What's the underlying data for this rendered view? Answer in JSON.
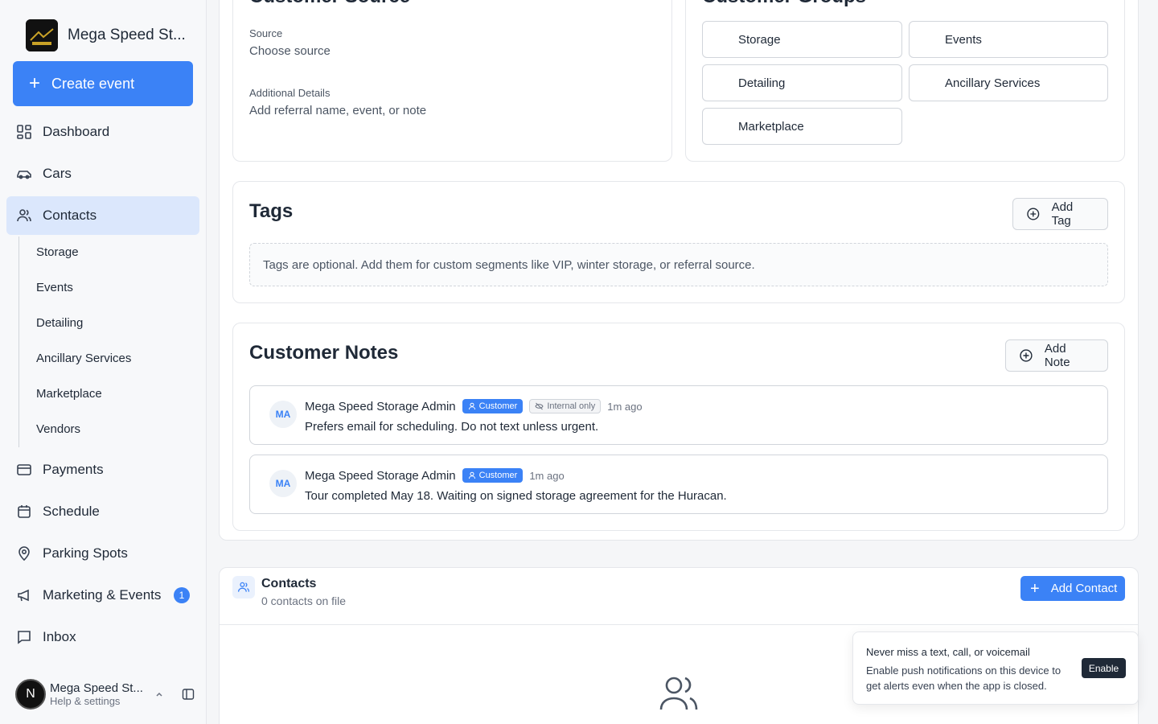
{
  "sidebar": {
    "brand_name": "Mega Speed St...",
    "create_label": "Create event",
    "nav": {
      "dashboard": "Dashboard",
      "cars": "Cars",
      "contacts": "Contacts",
      "payments": "Payments",
      "schedule": "Schedule",
      "parking": "Parking Spots",
      "marketing": "Marketing & Events",
      "marketing_badge": "1",
      "inbox": "Inbox"
    },
    "sub_items": [
      "Storage",
      "Events",
      "Detailing",
      "Ancillary Services",
      "Marketplace",
      "Vendors"
    ],
    "user": {
      "initial": "N",
      "name": "Mega Speed St...",
      "sub": "Help & settings"
    }
  },
  "customer_source": {
    "title": "Customer Source",
    "source_label": "Source",
    "source_value": "Choose source",
    "details_label": "Additional Details",
    "details_placeholder": "Add referral name, event, or note"
  },
  "customer_groups": {
    "title": "Customer Groups",
    "items": [
      "Storage",
      "Events",
      "Detailing",
      "Ancillary Services",
      "Marketplace"
    ]
  },
  "tags": {
    "title": "Tags",
    "add_label": "Add Tag",
    "empty_text": "Tags are optional. Add them for custom segments like VIP, winter storage, or referral source."
  },
  "notes": {
    "title": "Customer Notes",
    "add_label": "Add Note",
    "items": [
      {
        "initials": "MA",
        "author": "Mega Speed Storage Admin",
        "badge": "Customer",
        "internal": "Internal only",
        "time": "1m ago",
        "body": "Prefers email for scheduling. Do not text unless urgent."
      },
      {
        "initials": "MA",
        "author": "Mega Speed Storage Admin",
        "badge": "Customer",
        "time": "1m ago",
        "body": "Tour completed May 18. Waiting on signed storage agreement for the Huracan."
      }
    ]
  },
  "contacts": {
    "title": "Contacts",
    "subtitle": "0 contacts on file",
    "add_label": "Add Contact"
  },
  "toast": {
    "title": "Never miss a text, call, or voicemail",
    "body": "Enable push notifications on this device to get alerts even when the app is closed.",
    "button": "Enable"
  },
  "colors": {
    "accent": "#3b82f6",
    "active_nav": "#dbe7fc"
  }
}
